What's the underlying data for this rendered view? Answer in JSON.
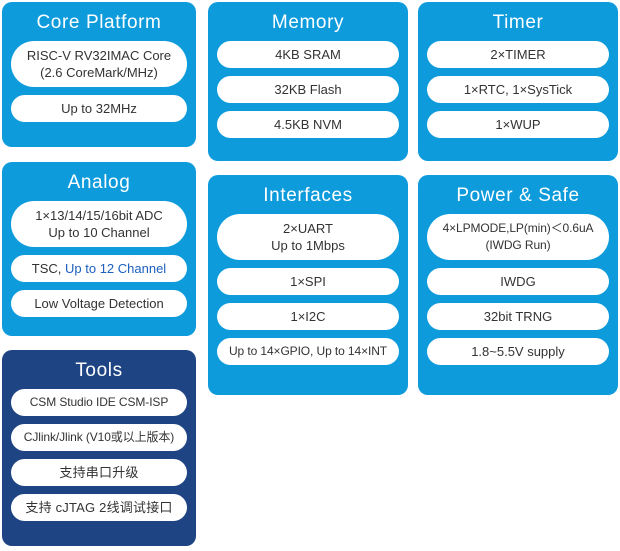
{
  "theme": {
    "panel_blue": "#0D9BDC",
    "panel_navy": "#1E4484",
    "pill_background": "#FFFFFF",
    "pill_text": "#333333",
    "accent_text": "#1B5FBF",
    "title_text": "#FFFFFF"
  },
  "panels": [
    {
      "id": "core-platform",
      "title": "Core Platform",
      "color": "blue",
      "items": [
        {
          "lines": [
            "RISC-V RV32IMAC Core",
            "(2.6 CoreMark/MHz)"
          ]
        },
        {
          "lines": [
            "Up to 32MHz"
          ]
        }
      ]
    },
    {
      "id": "memory",
      "title": "Memory",
      "color": "blue",
      "items": [
        {
          "lines": [
            "4KB SRAM"
          ]
        },
        {
          "lines": [
            "32KB Flash"
          ]
        },
        {
          "lines": [
            "4.5KB NVM"
          ]
        }
      ]
    },
    {
      "id": "timer",
      "title": "Timer",
      "color": "blue",
      "items": [
        {
          "lines": [
            "2×TIMER"
          ]
        },
        {
          "lines": [
            "1×RTC, 1×SysTick"
          ]
        },
        {
          "lines": [
            "1×WUP"
          ]
        }
      ]
    },
    {
      "id": "analog",
      "title": "Analog",
      "color": "blue",
      "items": [
        {
          "lines": [
            "1×13/14/15/16bit ADC",
            "Up to 10 Channel"
          ]
        },
        {
          "lines": [
            "TSC, "
          ],
          "accent": "Up to 12 Channel"
        },
        {
          "lines": [
            "Low Voltage Detection"
          ]
        }
      ]
    },
    {
      "id": "interfaces",
      "title": "Interfaces",
      "color": "blue",
      "items": [
        {
          "lines": [
            "2×UART",
            "Up to 1Mbps"
          ]
        },
        {
          "lines": [
            "1×SPI"
          ]
        },
        {
          "lines": [
            "1×I2C"
          ]
        },
        {
          "lines": [
            "Up to 14×GPIO, Up to 14×INT"
          ]
        }
      ]
    },
    {
      "id": "power-safe",
      "title": "Power & Safe",
      "color": "blue",
      "items": [
        {
          "lines": [
            "4×LPMODE,LP(min)＜0.6uA",
            "(IWDG Run)"
          ]
        },
        {
          "lines": [
            "IWDG"
          ]
        },
        {
          "lines": [
            "32bit TRNG"
          ]
        },
        {
          "lines": [
            "1.8~5.5V supply"
          ]
        }
      ]
    },
    {
      "id": "tools",
      "title": "Tools",
      "color": "navy",
      "items": [
        {
          "lines": [
            "CSM Studio IDE   CSM-ISP"
          ]
        },
        {
          "lines": [
            "CJlink/Jlink (V10或以上版本)"
          ]
        },
        {
          "lines": [
            "支持串口升级"
          ]
        },
        {
          "lines": [
            "支持 cJTAG 2线调试接口"
          ]
        }
      ]
    }
  ],
  "core_platform": {
    "title": "Core Platform",
    "item_0_line_0": "RISC-V RV32IMAC Core",
    "item_0_line_1": "(2.6 CoreMark/MHz)",
    "item_1_line_0": "Up to 32MHz"
  },
  "memory": {
    "title": "Memory",
    "item_0": "4KB SRAM",
    "item_1": "32KB Flash",
    "item_2": "4.5KB NVM"
  },
  "timer": {
    "title": "Timer",
    "item_0": "2×TIMER",
    "item_1": "1×RTC, 1×SysTick",
    "item_2": "1×WUP"
  },
  "analog": {
    "title": "Analog",
    "item_0_line_0": "1×13/14/15/16bit ADC",
    "item_0_line_1": "Up to 10 Channel",
    "item_1_prefix": "TSC, ",
    "item_1_accent": "Up to 12 Channel",
    "item_2": "Low Voltage Detection"
  },
  "interfaces": {
    "title": "Interfaces",
    "item_0_line_0": "2×UART",
    "item_0_line_1": "Up to 1Mbps",
    "item_1": "1×SPI",
    "item_2": "1×I2C",
    "item_3": "Up to 14×GPIO, Up to 14×INT"
  },
  "power_safe": {
    "title": "Power & Safe",
    "item_0_line_0": "4×LPMODE,LP(min)＜0.6uA",
    "item_0_line_1": "(IWDG Run)",
    "item_1": "IWDG",
    "item_2": "32bit TRNG",
    "item_3": "1.8~5.5V supply"
  },
  "tools": {
    "title": "Tools",
    "item_0": "CSM Studio IDE   CSM-ISP",
    "item_1": "CJlink/Jlink (V10或以上版本)",
    "item_2": "支持串口升级",
    "item_3": "支持 cJTAG 2线调试接口"
  }
}
